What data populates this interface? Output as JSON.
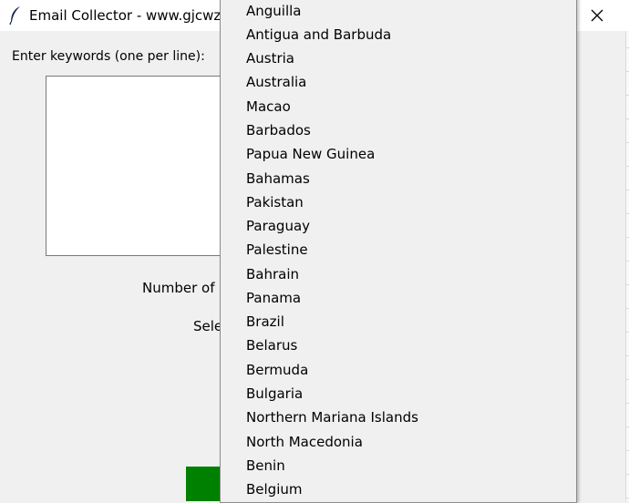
{
  "window": {
    "title": "Email Collector - www.gjcwz"
  },
  "form": {
    "keywords_label": "Enter keywords (one per line):",
    "keywords_value": "",
    "number_label": "Number of",
    "select_label": "Sele",
    "start_button_color": "#008000"
  },
  "dropdown": {
    "items": [
      "Anguilla",
      "Antigua and Barbuda",
      "Austria",
      "Australia",
      "Macao",
      "Barbados",
      "Papua New Guinea",
      "Bahamas",
      "Pakistan",
      "Paraguay",
      "Palestine",
      "Bahrain",
      "Panama",
      "Brazil",
      "Belarus",
      "Bermuda",
      "Bulgaria",
      "Northern Mariana Islands",
      "North Macedonia",
      "Benin",
      "Belgium"
    ]
  }
}
